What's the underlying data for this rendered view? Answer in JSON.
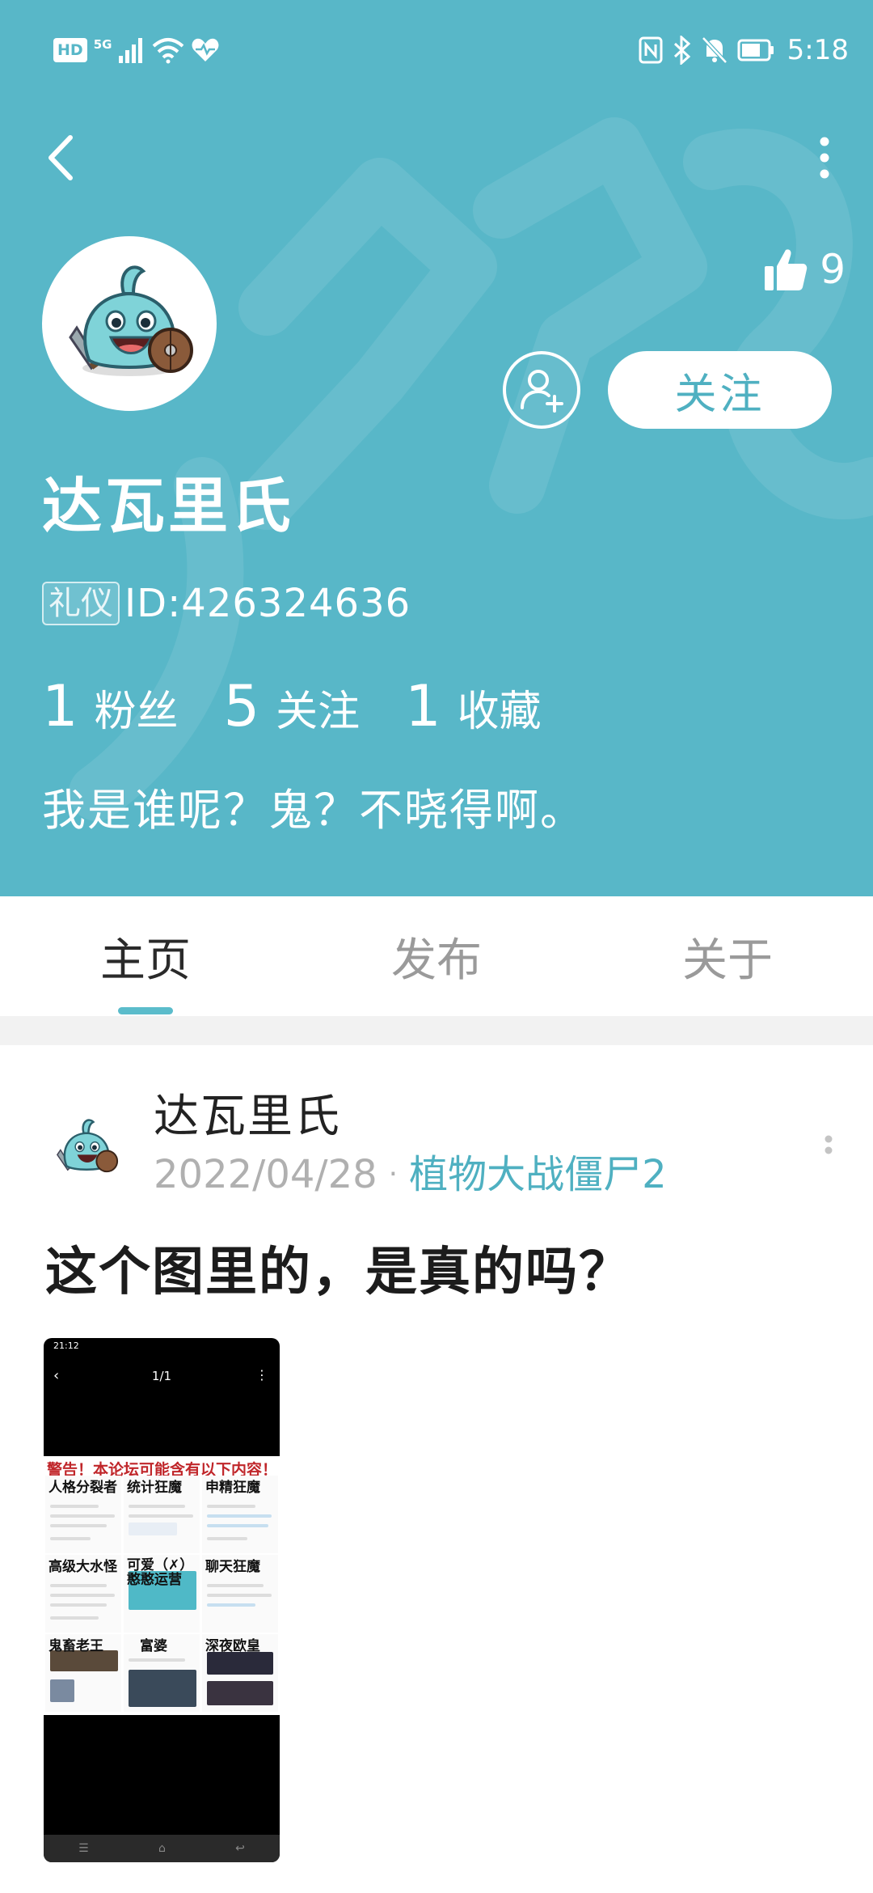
{
  "status_bar": {
    "network_badge": "HD",
    "network_type": "5G",
    "time": "5:18",
    "icons": [
      "signal-icon",
      "wifi-icon",
      "heart-icon",
      "nfc-icon",
      "bluetooth-icon",
      "mute-bell-icon",
      "battery-icon"
    ]
  },
  "header": {
    "likes_count": "9",
    "follow_label": "关注",
    "username": "达瓦里氏",
    "badge": "礼仪",
    "user_id": "ID:426324636",
    "stats": [
      {
        "num": "1",
        "label": "粉丝"
      },
      {
        "num": "5",
        "label": "关注"
      },
      {
        "num": "1",
        "label": "收藏"
      }
    ],
    "bio": "我是谁呢？鬼？不晓得啊。"
  },
  "tabs": [
    {
      "label": "主页",
      "active": true
    },
    {
      "label": "发布",
      "active": false
    },
    {
      "label": "关于",
      "active": false
    }
  ],
  "post": {
    "author": "达瓦里氏",
    "date": "2022/04/28",
    "separator": "·",
    "forum": "植物大战僵尸2",
    "title": "这个图里的，是真的吗？",
    "image": {
      "time": "21:12",
      "page": "1/1",
      "warning": "警告！本论坛可能含有以下内容！",
      "cells": [
        "人格分裂者",
        "统计狂魔",
        "申精狂魔",
        "高级大水怪",
        "可爱（✗）憨憨运营",
        "聊天狂魔",
        "鬼畜老王",
        "富婆",
        "深夜欧皇"
      ]
    }
  },
  "colors": {
    "header_bg": "#58b7c8",
    "accent": "#4fb0c1",
    "tab_indicator": "#5bbccb"
  }
}
